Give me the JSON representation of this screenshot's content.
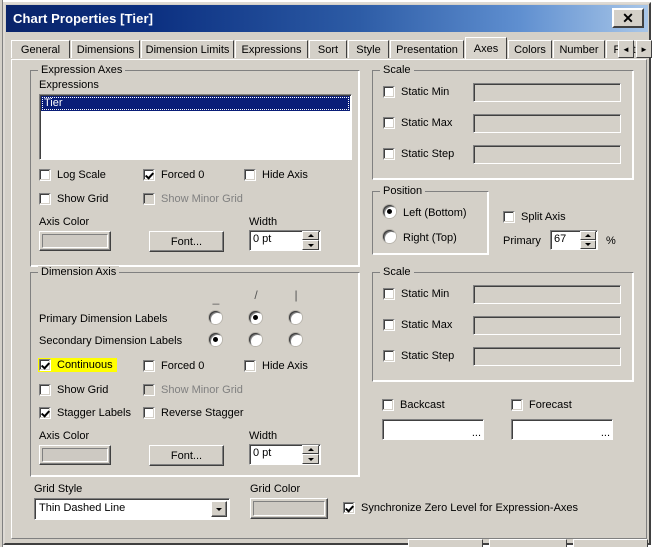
{
  "window": {
    "title": "Chart Properties [Tier]",
    "close_label": "✕"
  },
  "tabs": {
    "items": [
      {
        "label": "General",
        "selected": false
      },
      {
        "label": "Dimensions",
        "selected": false
      },
      {
        "label": "Dimension Limits",
        "selected": false
      },
      {
        "label": "Expressions",
        "selected": false
      },
      {
        "label": "Sort",
        "selected": false
      },
      {
        "label": "Style",
        "selected": false
      },
      {
        "label": "Presentation",
        "selected": false
      },
      {
        "label": "Axes",
        "selected": true
      },
      {
        "label": "Colors",
        "selected": false
      },
      {
        "label": "Number",
        "selected": false
      },
      {
        "label": "Font",
        "selected": false
      }
    ],
    "scroll_left": "◄",
    "scroll_right": "►"
  },
  "expression_axes": {
    "group_title": "Expression Axes",
    "expressions_label": "Expressions",
    "selected_expression": "Tier",
    "log_scale": {
      "label": "Log Scale",
      "checked": false
    },
    "forced_0": {
      "label": "Forced 0",
      "checked": true
    },
    "hide_axis": {
      "label": "Hide Axis",
      "checked": false
    },
    "show_grid": {
      "label": "Show Grid",
      "checked": false
    },
    "show_minor_grid": {
      "label": "Show Minor Grid",
      "checked": false,
      "disabled": true
    },
    "axis_color_label": "Axis Color",
    "font_button": "Font...",
    "width_label": "Width",
    "width_value": "0 pt"
  },
  "expression_scale": {
    "group_title": "Scale",
    "static_min": {
      "label": "Static Min",
      "checked": false,
      "value": ""
    },
    "static_max": {
      "label": "Static Max",
      "checked": false,
      "value": ""
    },
    "static_step": {
      "label": "Static Step",
      "checked": false,
      "value": ""
    }
  },
  "position": {
    "group_title": "Position",
    "left_bottom": {
      "label": "Left (Bottom)",
      "selected": true
    },
    "right_top": {
      "label": "Right (Top)",
      "selected": false
    },
    "split_axis": {
      "label": "Split Axis",
      "checked": false
    },
    "primary_label": "Primary",
    "primary_value": "67",
    "percent_sign": "%"
  },
  "dimension_axis": {
    "group_title": "Dimension Axis",
    "col_headers": [
      "_",
      "/",
      "|"
    ],
    "primary_labels": {
      "label": "Primary Dimension Labels",
      "selected_index": 1
    },
    "secondary_labels": {
      "label": "Secondary Dimension Labels",
      "selected_index": 0
    },
    "continuous": {
      "label": "Continuous",
      "checked": true,
      "highlighted": true
    },
    "forced_0": {
      "label": "Forced 0",
      "checked": false
    },
    "hide_axis": {
      "label": "Hide Axis",
      "checked": false
    },
    "show_grid": {
      "label": "Show Grid",
      "checked": false
    },
    "show_minor_grid": {
      "label": "Show Minor Grid",
      "checked": false,
      "disabled": true
    },
    "stagger_labels": {
      "label": "Stagger Labels",
      "checked": true
    },
    "reverse_stagger": {
      "label": "Reverse Stagger",
      "checked": false
    },
    "axis_color_label": "Axis Color",
    "font_button": "Font...",
    "width_label": "Width",
    "width_value": "0 pt"
  },
  "dimension_scale": {
    "group_title": "Scale",
    "static_min": {
      "label": "Static Min",
      "checked": false,
      "value": ""
    },
    "static_max": {
      "label": "Static Max",
      "checked": false,
      "value": ""
    },
    "static_step": {
      "label": "Static Step",
      "checked": false,
      "value": ""
    },
    "backcast": {
      "label": "Backcast",
      "checked": false,
      "value": "",
      "browse": "..."
    },
    "forecast": {
      "label": "Forecast",
      "checked": false,
      "value": "",
      "browse": "..."
    }
  },
  "bottom": {
    "grid_style_label": "Grid Style",
    "grid_style_value": "Thin Dashed Line",
    "grid_color_label": "Grid Color",
    "sync_zero": {
      "label": "Synchronize Zero Level for Expression-Axes",
      "checked": true
    }
  },
  "colors": {
    "title_gradient_start": "#0a246a",
    "title_gradient_end": "#a8c6e8",
    "face": "#d4d0c8",
    "selection": "#0a1e78",
    "highlight": "#ffff00",
    "disabled_text": "#808080"
  }
}
